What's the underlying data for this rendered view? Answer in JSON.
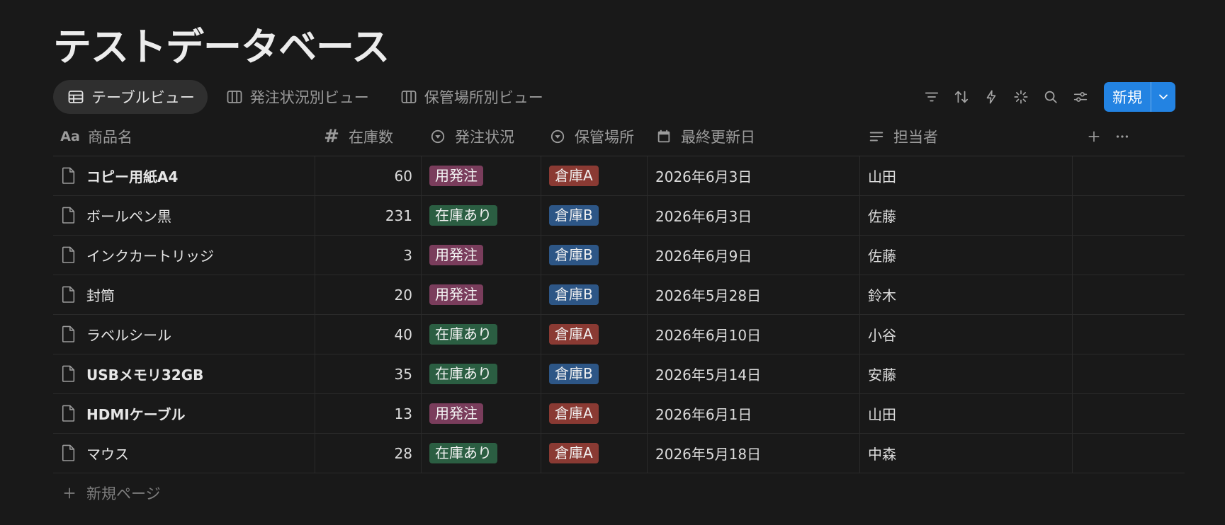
{
  "page": {
    "title": "テストデータベース"
  },
  "views": [
    {
      "label": "テーブルビュー",
      "icon": "table-icon",
      "active": true
    },
    {
      "label": "発注状況別ビュー",
      "icon": "board-icon",
      "active": false
    },
    {
      "label": "保管場所別ビュー",
      "icon": "board-icon",
      "active": false
    }
  ],
  "toolbar": {
    "icons": [
      "filter-icon",
      "sort-icon",
      "automation-icon",
      "ai-sparkle-icon",
      "search-icon",
      "settings-icon"
    ],
    "new_label": "新規"
  },
  "table": {
    "columns": [
      {
        "label": "商品名",
        "icon": "Aa"
      },
      {
        "label": "在庫数",
        "icon": "#"
      },
      {
        "label": "発注状況",
        "icon": "status-icon"
      },
      {
        "label": "保管場所",
        "icon": "status-icon"
      },
      {
        "label": "最終更新日",
        "icon": "calendar-icon"
      },
      {
        "label": "担当者",
        "icon": "text-icon"
      }
    ],
    "rows": [
      {
        "name": "コピー用紙A4",
        "stock": "60",
        "status": "用発注",
        "location": "倉庫A",
        "updated": "2026年6月3日",
        "owner": "山田"
      },
      {
        "name": "ボールペン黒",
        "stock": "231",
        "status": "在庫あり",
        "location": "倉庫B",
        "updated": "2026年6月3日",
        "owner": "佐藤"
      },
      {
        "name": "インクカートリッジ",
        "stock": "3",
        "status": "用発注",
        "location": "倉庫B",
        "updated": "2026年6月9日",
        "owner": "佐藤"
      },
      {
        "name": "封筒",
        "stock": "20",
        "status": "用発注",
        "location": "倉庫B",
        "updated": "2026年5月28日",
        "owner": "鈴木"
      },
      {
        "name": "ラベルシール",
        "stock": "40",
        "status": "在庫あり",
        "location": "倉庫A",
        "updated": "2026年6月10日",
        "owner": "小谷"
      },
      {
        "name": "USBメモリ32GB",
        "stock": "35",
        "status": "在庫あり",
        "location": "倉庫B",
        "updated": "2026年5月14日",
        "owner": "安藤"
      },
      {
        "name": "HDMIケーブル",
        "stock": "13",
        "status": "用発注",
        "location": "倉庫A",
        "updated": "2026年6月1日",
        "owner": "山田"
      },
      {
        "name": "マウス",
        "stock": "28",
        "status": "在庫あり",
        "location": "倉庫A",
        "updated": "2026年5月18日",
        "owner": "中森"
      }
    ],
    "add_row_label": "新規ページ"
  },
  "colors": {
    "status": {
      "用発注": "#7a3d5c",
      "在庫あり": "#2b5e42"
    },
    "location": {
      "倉庫A": "#8a3a33",
      "倉庫B": "#2d5686"
    },
    "accent": "#2383e2"
  }
}
